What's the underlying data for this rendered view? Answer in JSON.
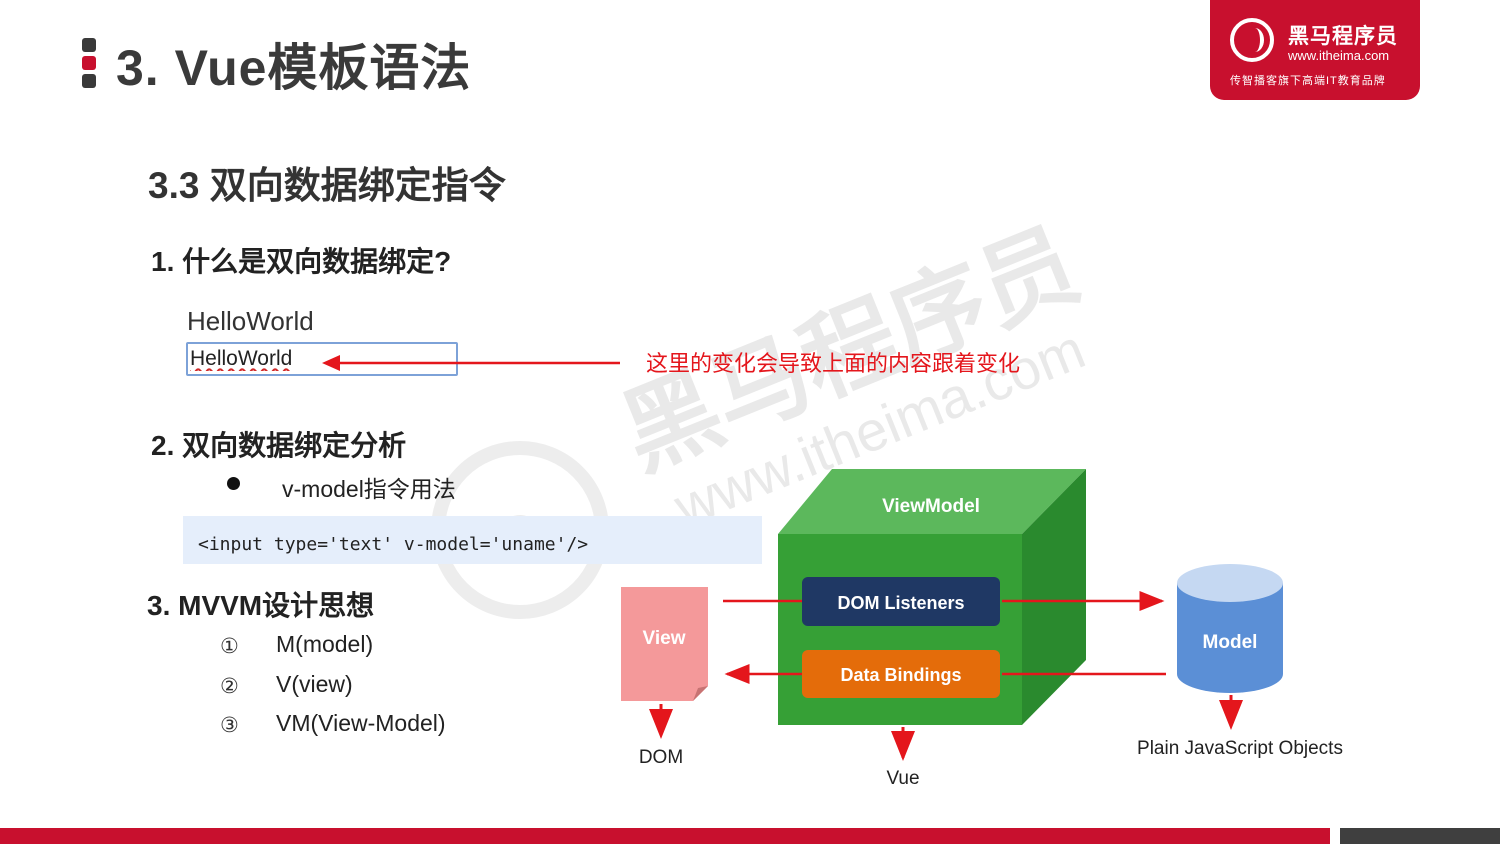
{
  "header": {
    "title": "3. Vue模板语法",
    "logo": {
      "name": "黑马程序员",
      "url": "www.itheima.com",
      "slogan": "传智播客旗下高端IT教育品牌"
    }
  },
  "section": {
    "title": "3.3 双向数据绑定指令",
    "q1": {
      "heading": "1. 什么是双向数据绑定?",
      "demo_text": "HelloWorld",
      "demo_input_value": "HelloWorld",
      "note": "这里的变化会导致上面的内容跟着变化"
    },
    "q2": {
      "heading": "2. 双向数据绑定分析",
      "bullet": "v-model指令用法",
      "code": "<input type='text' v-model='uname'/>"
    },
    "q3": {
      "heading": "3. MVVM设计思想",
      "items": [
        {
          "mark": "①",
          "text": "M(model)"
        },
        {
          "mark": "②",
          "text": "V(view)"
        },
        {
          "mark": "③",
          "text": "VM(View-Model)"
        }
      ]
    }
  },
  "diagram": {
    "view_label": "View",
    "dom_label": "DOM",
    "viewmodel_label": "ViewModel",
    "dom_listeners_label": "DOM Listeners",
    "data_bindings_label": "Data Bindings",
    "vue_label": "Vue",
    "model_label": "Model",
    "plain_js_label": "Plain JavaScript Objects"
  },
  "colors": {
    "brand_red": "#c8102e",
    "accent_red": "#e4161c",
    "cube_front": "#36a036",
    "cube_top": "#5cb85c",
    "cube_side": "#2a8a2e",
    "dom_listeners": "#1f3864",
    "data_bindings": "#e46c0a",
    "view_paper": "#f4999a",
    "model_cylinder": "#5b8fd6",
    "code_bg": "#e5eefb"
  }
}
